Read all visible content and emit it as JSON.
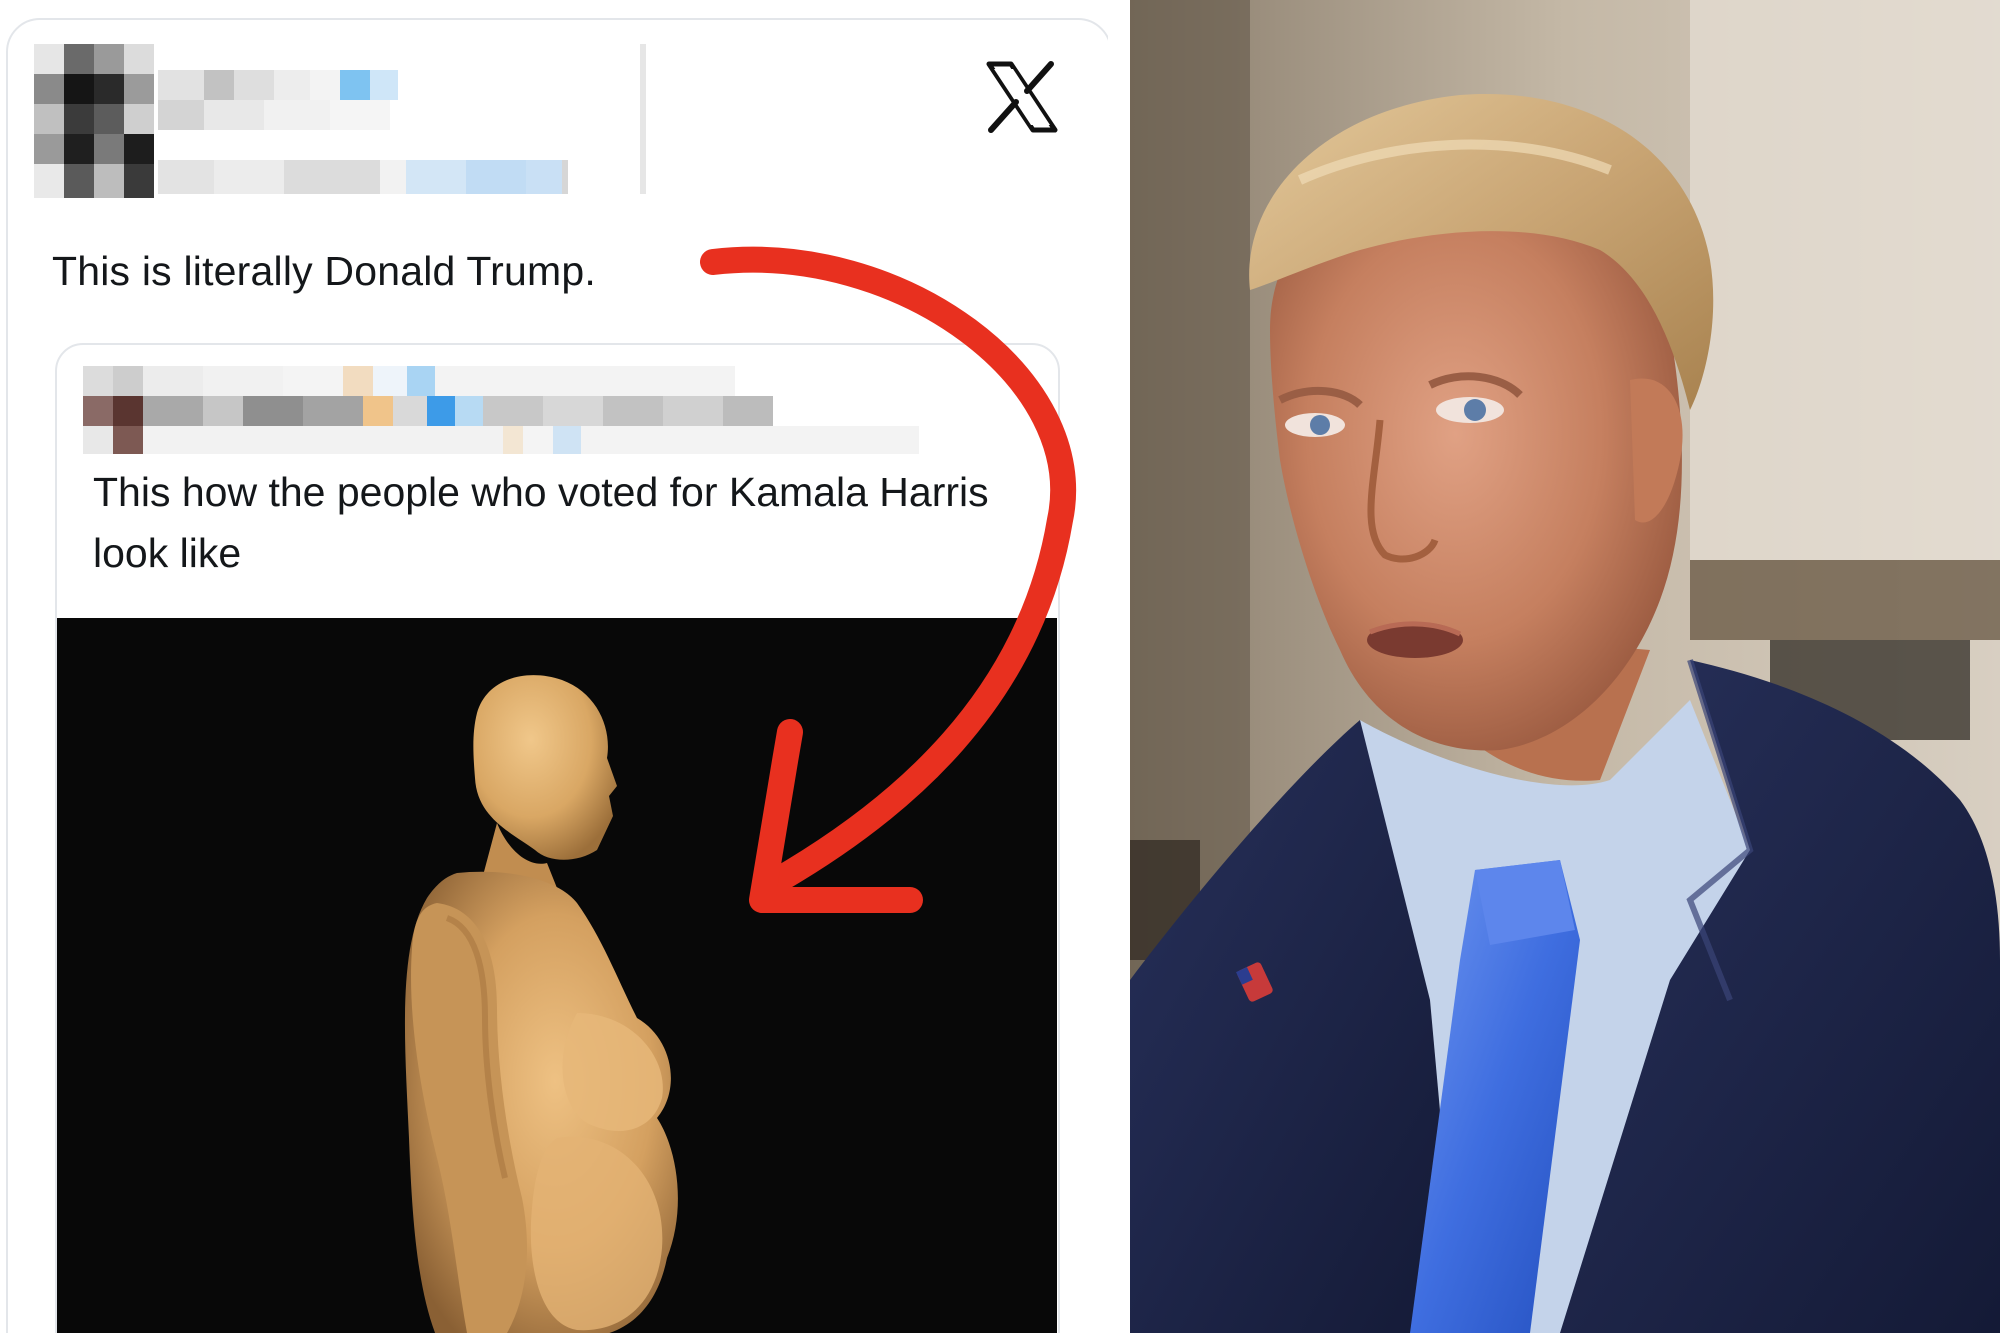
{
  "tweet": {
    "text": "This is literally Donald Trump.",
    "platform_icon": "x-logo-icon"
  },
  "quoted_tweet": {
    "text": "This how the  people who voted for Kamala Harris look like",
    "media_subject": "3d-body-figure"
  },
  "annotation": {
    "arrow_color": "#e8301f",
    "arrow_icon": "curved-arrow-icon"
  },
  "colors": {
    "media_background": "#080808",
    "figure_skin": "#d9a764",
    "suit": "#1b2347",
    "tie": "#3f6ee0",
    "shirt": "#c4d3ea"
  }
}
